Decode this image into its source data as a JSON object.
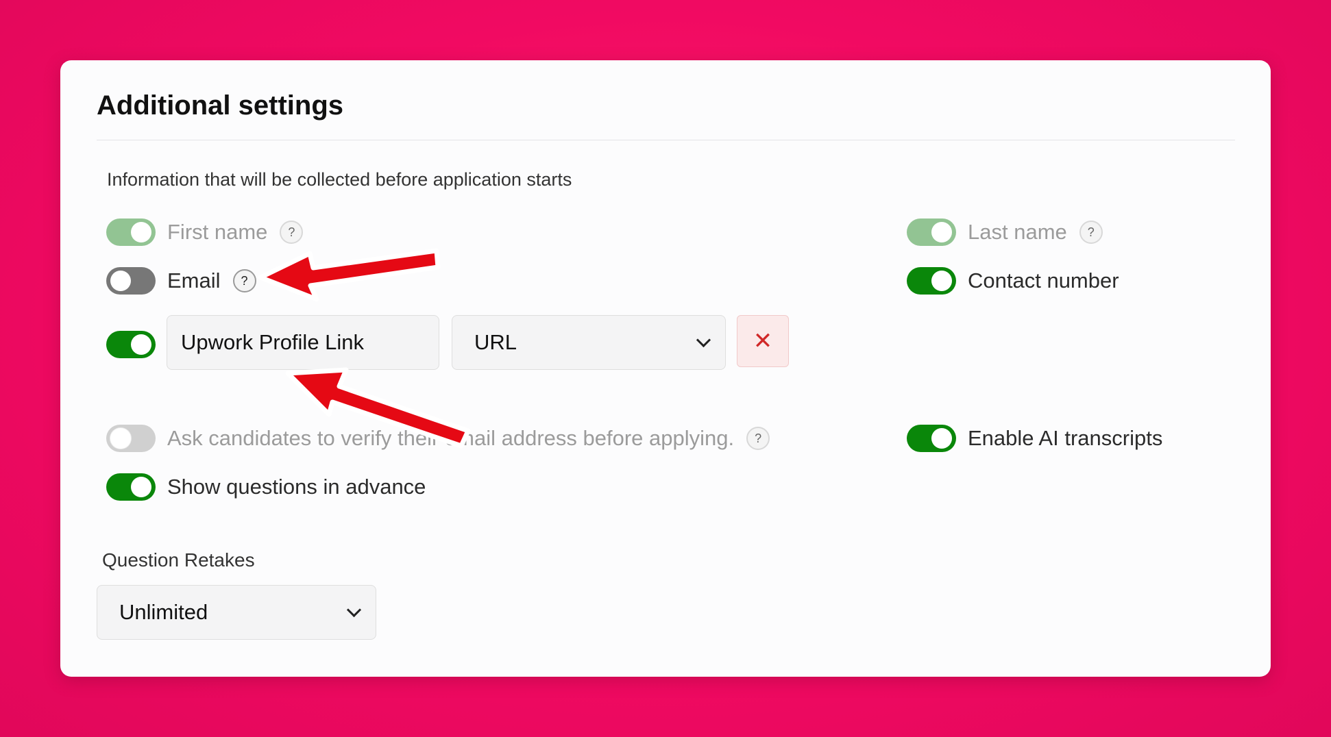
{
  "panel": {
    "title": "Additional settings",
    "section_label": "Information that will be collected before application starts"
  },
  "fields": {
    "first_name": {
      "label": "First name",
      "enabled": true,
      "locked": true,
      "help": "?"
    },
    "last_name": {
      "label": "Last name",
      "enabled": true,
      "locked": true,
      "help": "?"
    },
    "email": {
      "label": "Email",
      "enabled": false,
      "help": "?"
    },
    "contact_number": {
      "label": "Contact number",
      "enabled": true
    },
    "custom_field": {
      "enabled": true,
      "name_value": "Upwork Profile Link",
      "type_value": "URL",
      "remove_icon": "close-icon",
      "remove_symbol": "✕"
    }
  },
  "options": {
    "verify_email": {
      "label": "Ask candidates to verify their email address before applying.",
      "enabled": false,
      "disabled": true,
      "help": "?"
    },
    "ai_transcripts": {
      "label": "Enable AI transcripts",
      "enabled": true
    },
    "show_questions": {
      "label": "Show questions in advance",
      "enabled": true
    }
  },
  "retakes": {
    "label": "Question Retakes",
    "value": "Unlimited"
  },
  "annotations": {
    "arrow_color": "#e50914",
    "arrow_outline": "#ffffff",
    "arrow_count": 2
  },
  "colors": {
    "background": "#f10a62",
    "toggle_on": "#0a870a",
    "toggle_off": "#777777",
    "remove_icon": "#d02828"
  }
}
